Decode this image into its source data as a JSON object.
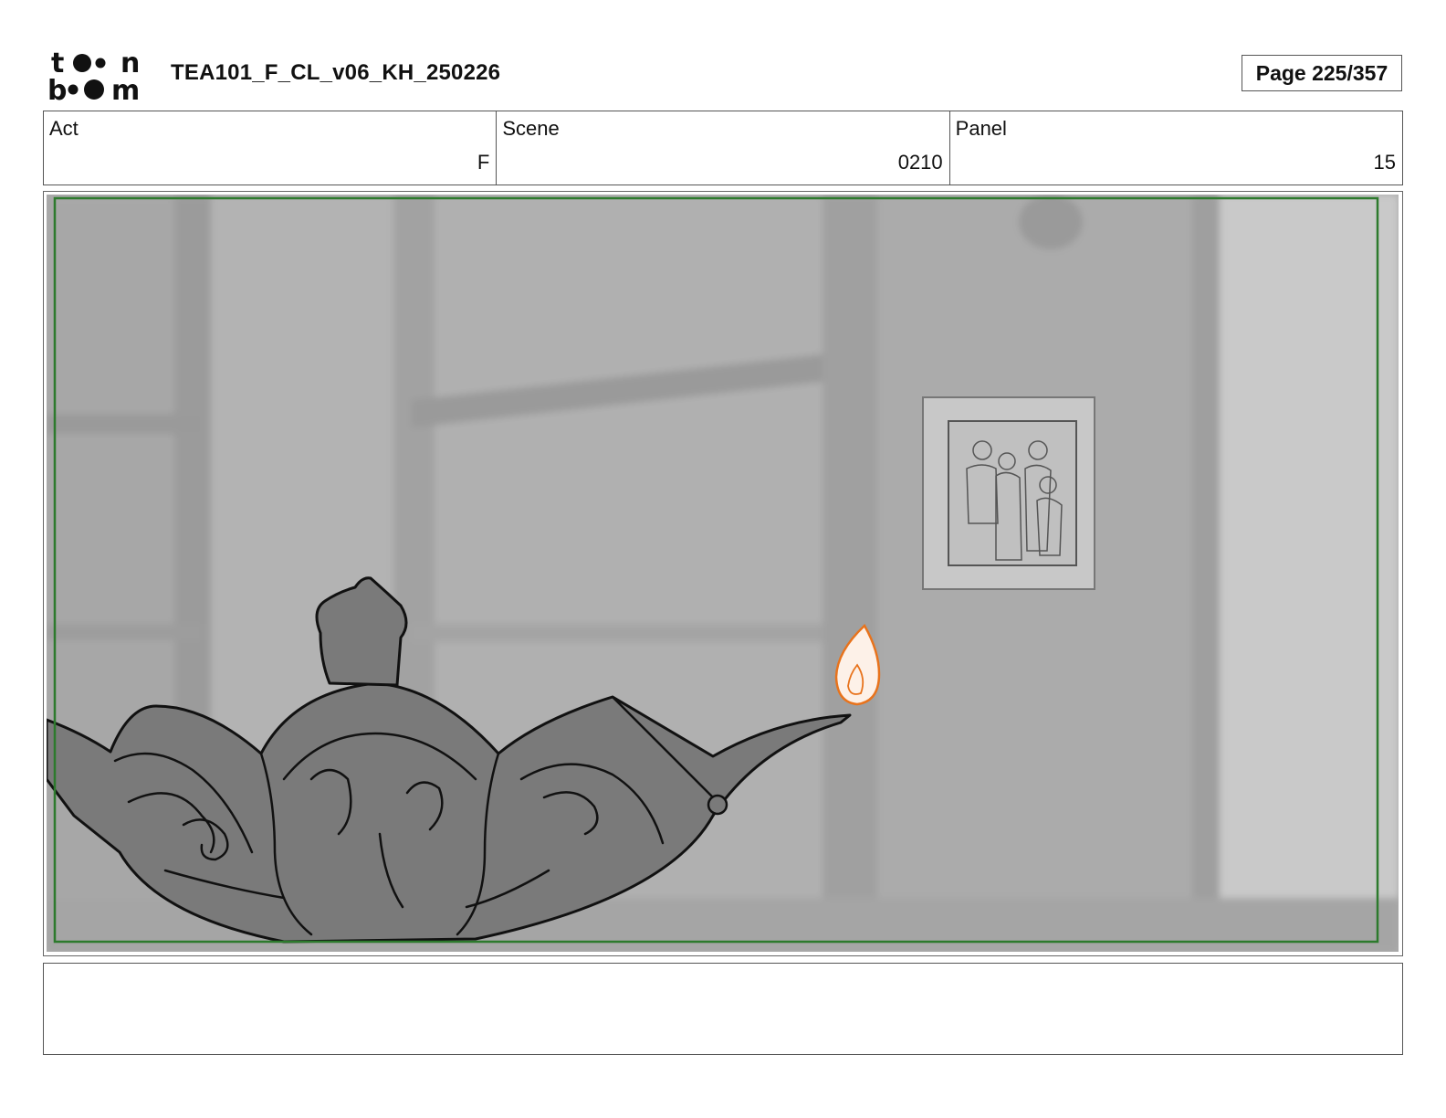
{
  "header": {
    "logo_alt": "toon boom",
    "document_title": "TEA101_F_CL_v06_KH_250226",
    "page_label": "Page 225/357"
  },
  "info": [
    {
      "label": "Act",
      "value": "F"
    },
    {
      "label": "Scene",
      "value": "0210"
    },
    {
      "label": "Panel",
      "value": "15"
    }
  ],
  "panel": {
    "safe_frame_color": "#2d7a2d",
    "flame_color": "#e8731c"
  },
  "caption": {
    "text": ""
  }
}
